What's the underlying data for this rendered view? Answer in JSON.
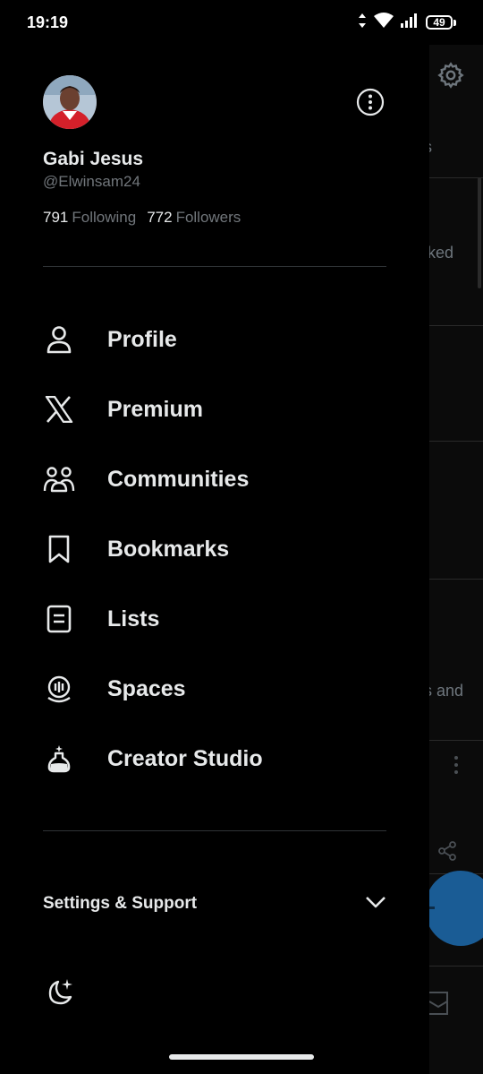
{
  "status_bar": {
    "time": "19:19",
    "battery": "49"
  },
  "profile": {
    "name": "Gabi Jesus",
    "handle": "@Elwinsam24",
    "following_count": "791",
    "following_label": "Following",
    "followers_count": "772",
    "followers_label": "Followers"
  },
  "menu": [
    {
      "label": "Profile",
      "icon": "person-icon"
    },
    {
      "label": "Premium",
      "icon": "x-logo-icon"
    },
    {
      "label": "Communities",
      "icon": "communities-icon"
    },
    {
      "label": "Bookmarks",
      "icon": "bookmark-icon"
    },
    {
      "label": "Lists",
      "icon": "list-icon"
    },
    {
      "label": "Spaces",
      "icon": "spaces-icon"
    },
    {
      "label": "Creator Studio",
      "icon": "flask-icon"
    }
  ],
  "settings": {
    "label": "Settings & Support"
  },
  "background_peek": {
    "texts": [
      "s",
      "iked",
      "s and"
    ]
  },
  "colors": {
    "background": "#000000",
    "text_primary": "#e7e9ea",
    "text_secondary": "#71767b",
    "divider": "#2f3336",
    "fab": "#1d9bf0"
  }
}
